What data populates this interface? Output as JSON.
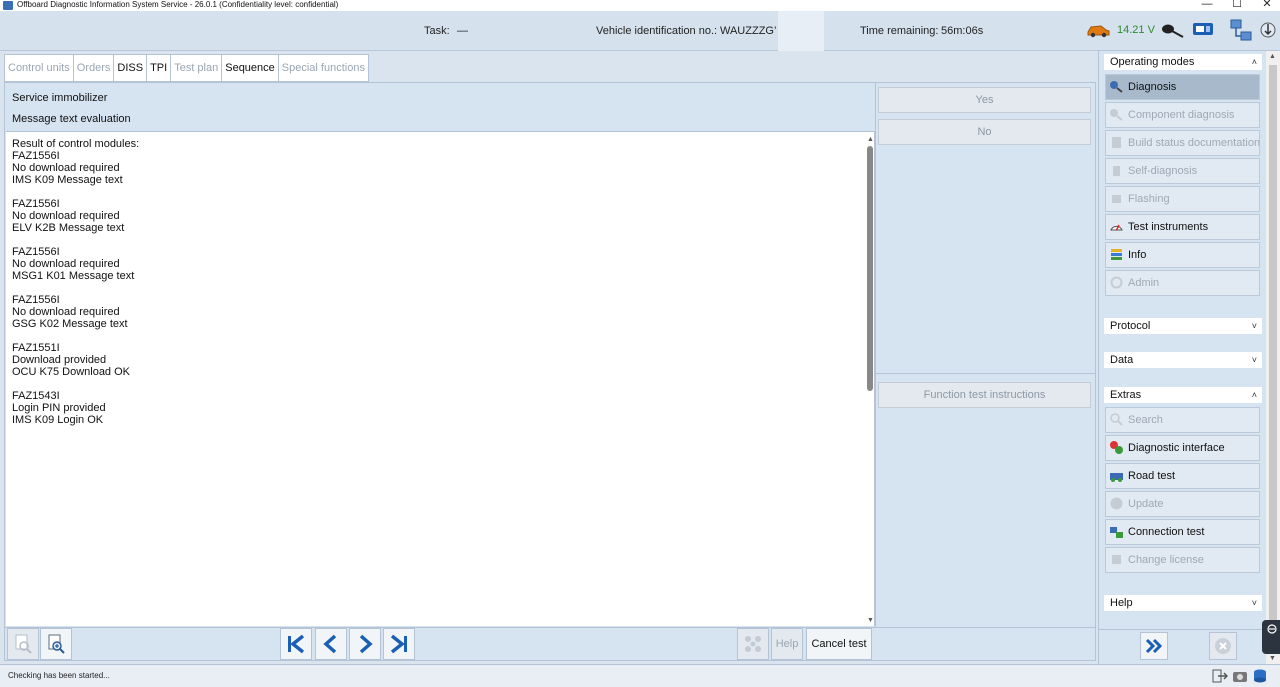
{
  "window": {
    "title": "Offboard Diagnostic Information System Service - 26.0.1 (Confidentiality level: confidential)",
    "minimize": "—",
    "maximize": "☐",
    "close": "✕"
  },
  "header": {
    "task_label": "Task:",
    "task_value": "—",
    "vin_label": "Vehicle identification no.:",
    "vin_value": "WAUZZZG’",
    "time_label": "Time remaining:",
    "time_value": "56m:06s",
    "voltage": "14.21 V",
    "voltage_color": "#2f8a2f",
    "icons": [
      "car-battery-icon",
      "obd-connector-icon",
      "usb-device-icon",
      "network-icon",
      "info-arrow-icon"
    ]
  },
  "tabs": [
    {
      "label": "Control units",
      "enabled": false
    },
    {
      "label": "Orders",
      "enabled": false
    },
    {
      "label": "DISS",
      "enabled": true
    },
    {
      "label": "TPI",
      "enabled": true
    },
    {
      "label": "Test plan",
      "enabled": false
    },
    {
      "label": "Sequence",
      "enabled": true,
      "active": true
    },
    {
      "label": "Special functions",
      "enabled": false
    }
  ],
  "info": {
    "line1": "Service immobilizer",
    "line2": "Message text evaluation"
  },
  "result_text": "Result of control modules:\nFAZ1556I\nNo download required\nIMS K09 Message text\n\nFAZ1556I\nNo download required\nELV K2B Message text\n\nFAZ1556I\nNo download required\nMSG1 K01 Message text\n\nFAZ1556I\nNo download required\nGSG K02 Message text\n\nFAZ1551I\nDownload provided\nOCU K75 Download OK\n\nFAZ1543I\nLogin PIN provided\nIMS K09 Login OK",
  "mid": {
    "yes": "Yes",
    "no": "No",
    "function_test": "Function test instructions"
  },
  "toolbar": {
    "zoom_out": "zoom-out-icon",
    "zoom_in": "zoom-in-icon",
    "first": "skip-first-icon",
    "prev": "prev-icon",
    "next": "next-icon",
    "last": "skip-last-icon",
    "share": "network-nodes-icon",
    "help": "Help",
    "cancel": "Cancel test"
  },
  "side": {
    "operating_modes": "Operating modes",
    "operating_items": [
      {
        "label": "Diagnosis",
        "enabled": true,
        "active": true,
        "icon": "stethoscope-icon"
      },
      {
        "label": "Component diagnosis",
        "enabled": false,
        "icon": "component-icon"
      },
      {
        "label": "Build status documentation",
        "enabled": false,
        "icon": "document-icon"
      },
      {
        "label": "Self-diagnosis",
        "enabled": false,
        "icon": "self-diagnosis-icon"
      },
      {
        "label": "Flashing",
        "enabled": false,
        "icon": "flash-icon"
      },
      {
        "label": "Test instruments",
        "enabled": true,
        "icon": "gauge-icon"
      },
      {
        "label": "Info",
        "enabled": true,
        "icon": "books-icon"
      },
      {
        "label": "Admin",
        "enabled": false,
        "icon": "admin-icon"
      }
    ],
    "protocol": "Protocol",
    "data": "Data",
    "extras": "Extras",
    "extras_items": [
      {
        "label": "Search",
        "enabled": false,
        "icon": "search-icon"
      },
      {
        "label": "Diagnostic interface",
        "enabled": true,
        "icon": "diagnostic-interface-icon"
      },
      {
        "label": "Road test",
        "enabled": true,
        "icon": "road-test-icon"
      },
      {
        "label": "Update",
        "enabled": false,
        "icon": "update-icon"
      },
      {
        "label": "Connection test",
        "enabled": true,
        "icon": "connection-test-icon"
      },
      {
        "label": "Change license",
        "enabled": false,
        "icon": "license-icon"
      }
    ],
    "help": "Help",
    "chev_up": "˄",
    "chev_down": "˅"
  },
  "status": {
    "text": "Checking has been started..."
  },
  "colors": {
    "panel": "#d6e3f0",
    "accent": "#1a5fb4"
  }
}
